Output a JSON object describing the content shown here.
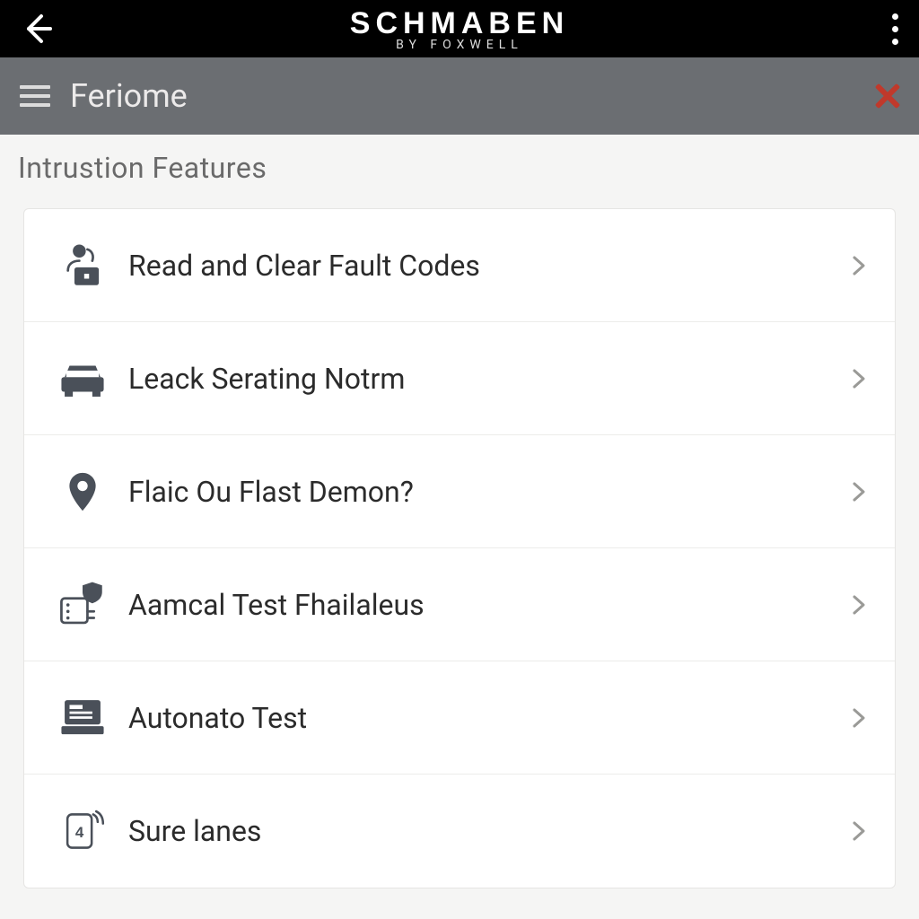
{
  "appbar": {
    "brand_main": "SCHMABEN",
    "brand_sub": "BY FOXWELL"
  },
  "subbar": {
    "title": "Feriome"
  },
  "section_title": "Intrustion Features",
  "items": [
    {
      "icon": "person-briefcase-icon",
      "label": "Read and Clear Fault Codes"
    },
    {
      "icon": "car-icon",
      "label": "Leack Serating Notrm"
    },
    {
      "icon": "pin-icon",
      "label": "Flaic Ou Flast Demon?"
    },
    {
      "icon": "shield-chip-icon",
      "label": "Aamcal Test Fhailaleus"
    },
    {
      "icon": "laptop-icon",
      "label": "Autonato Test"
    },
    {
      "icon": "sim-signal-icon",
      "label": "Sure lanes"
    }
  ],
  "colors": {
    "accent_close": "#c0392b",
    "icon": "#4a5059"
  }
}
